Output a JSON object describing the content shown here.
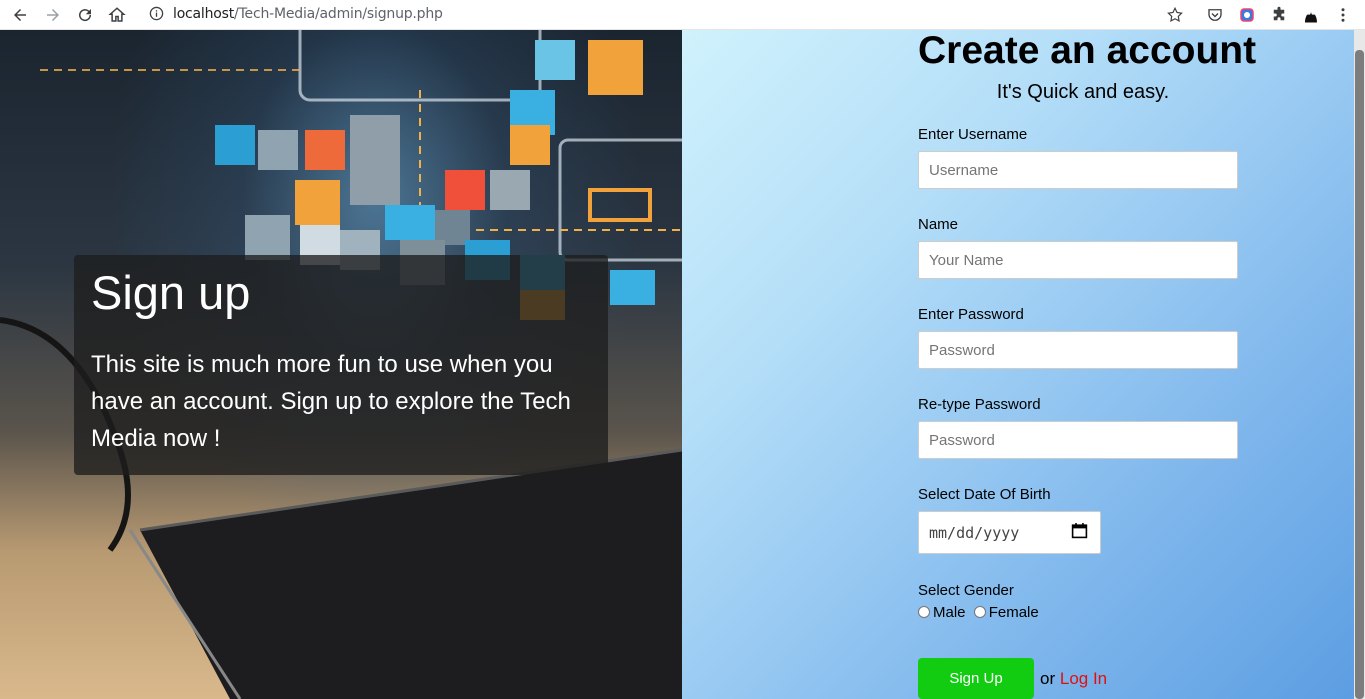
{
  "browser": {
    "url_host": "localhost",
    "url_path": "/Tech-Media/admin/signup.php"
  },
  "hero": {
    "title": "Sign up",
    "text": "This site is much more fun to use when you have an account. Sign up to explore the Tech Media now !"
  },
  "form": {
    "title": "Create an account",
    "subtitle": "It's Quick and easy.",
    "username": {
      "label": "Enter Username",
      "placeholder": "Username"
    },
    "name": {
      "label": "Name",
      "placeholder": "Your Name"
    },
    "password": {
      "label": "Enter Password",
      "placeholder": "Password"
    },
    "retype": {
      "label": "Re-type Password",
      "placeholder": "Password"
    },
    "dob": {
      "label": "Select Date Of Birth",
      "placeholder": "mm/dd/yyyy"
    },
    "gender": {
      "label": "Select Gender",
      "options": [
        "Male",
        "Female"
      ]
    },
    "submit_label": "Sign Up",
    "or_text": "or",
    "login_label": "Log In"
  },
  "colors": {
    "submit_bg": "#12cc12",
    "login_link": "#e01010"
  }
}
